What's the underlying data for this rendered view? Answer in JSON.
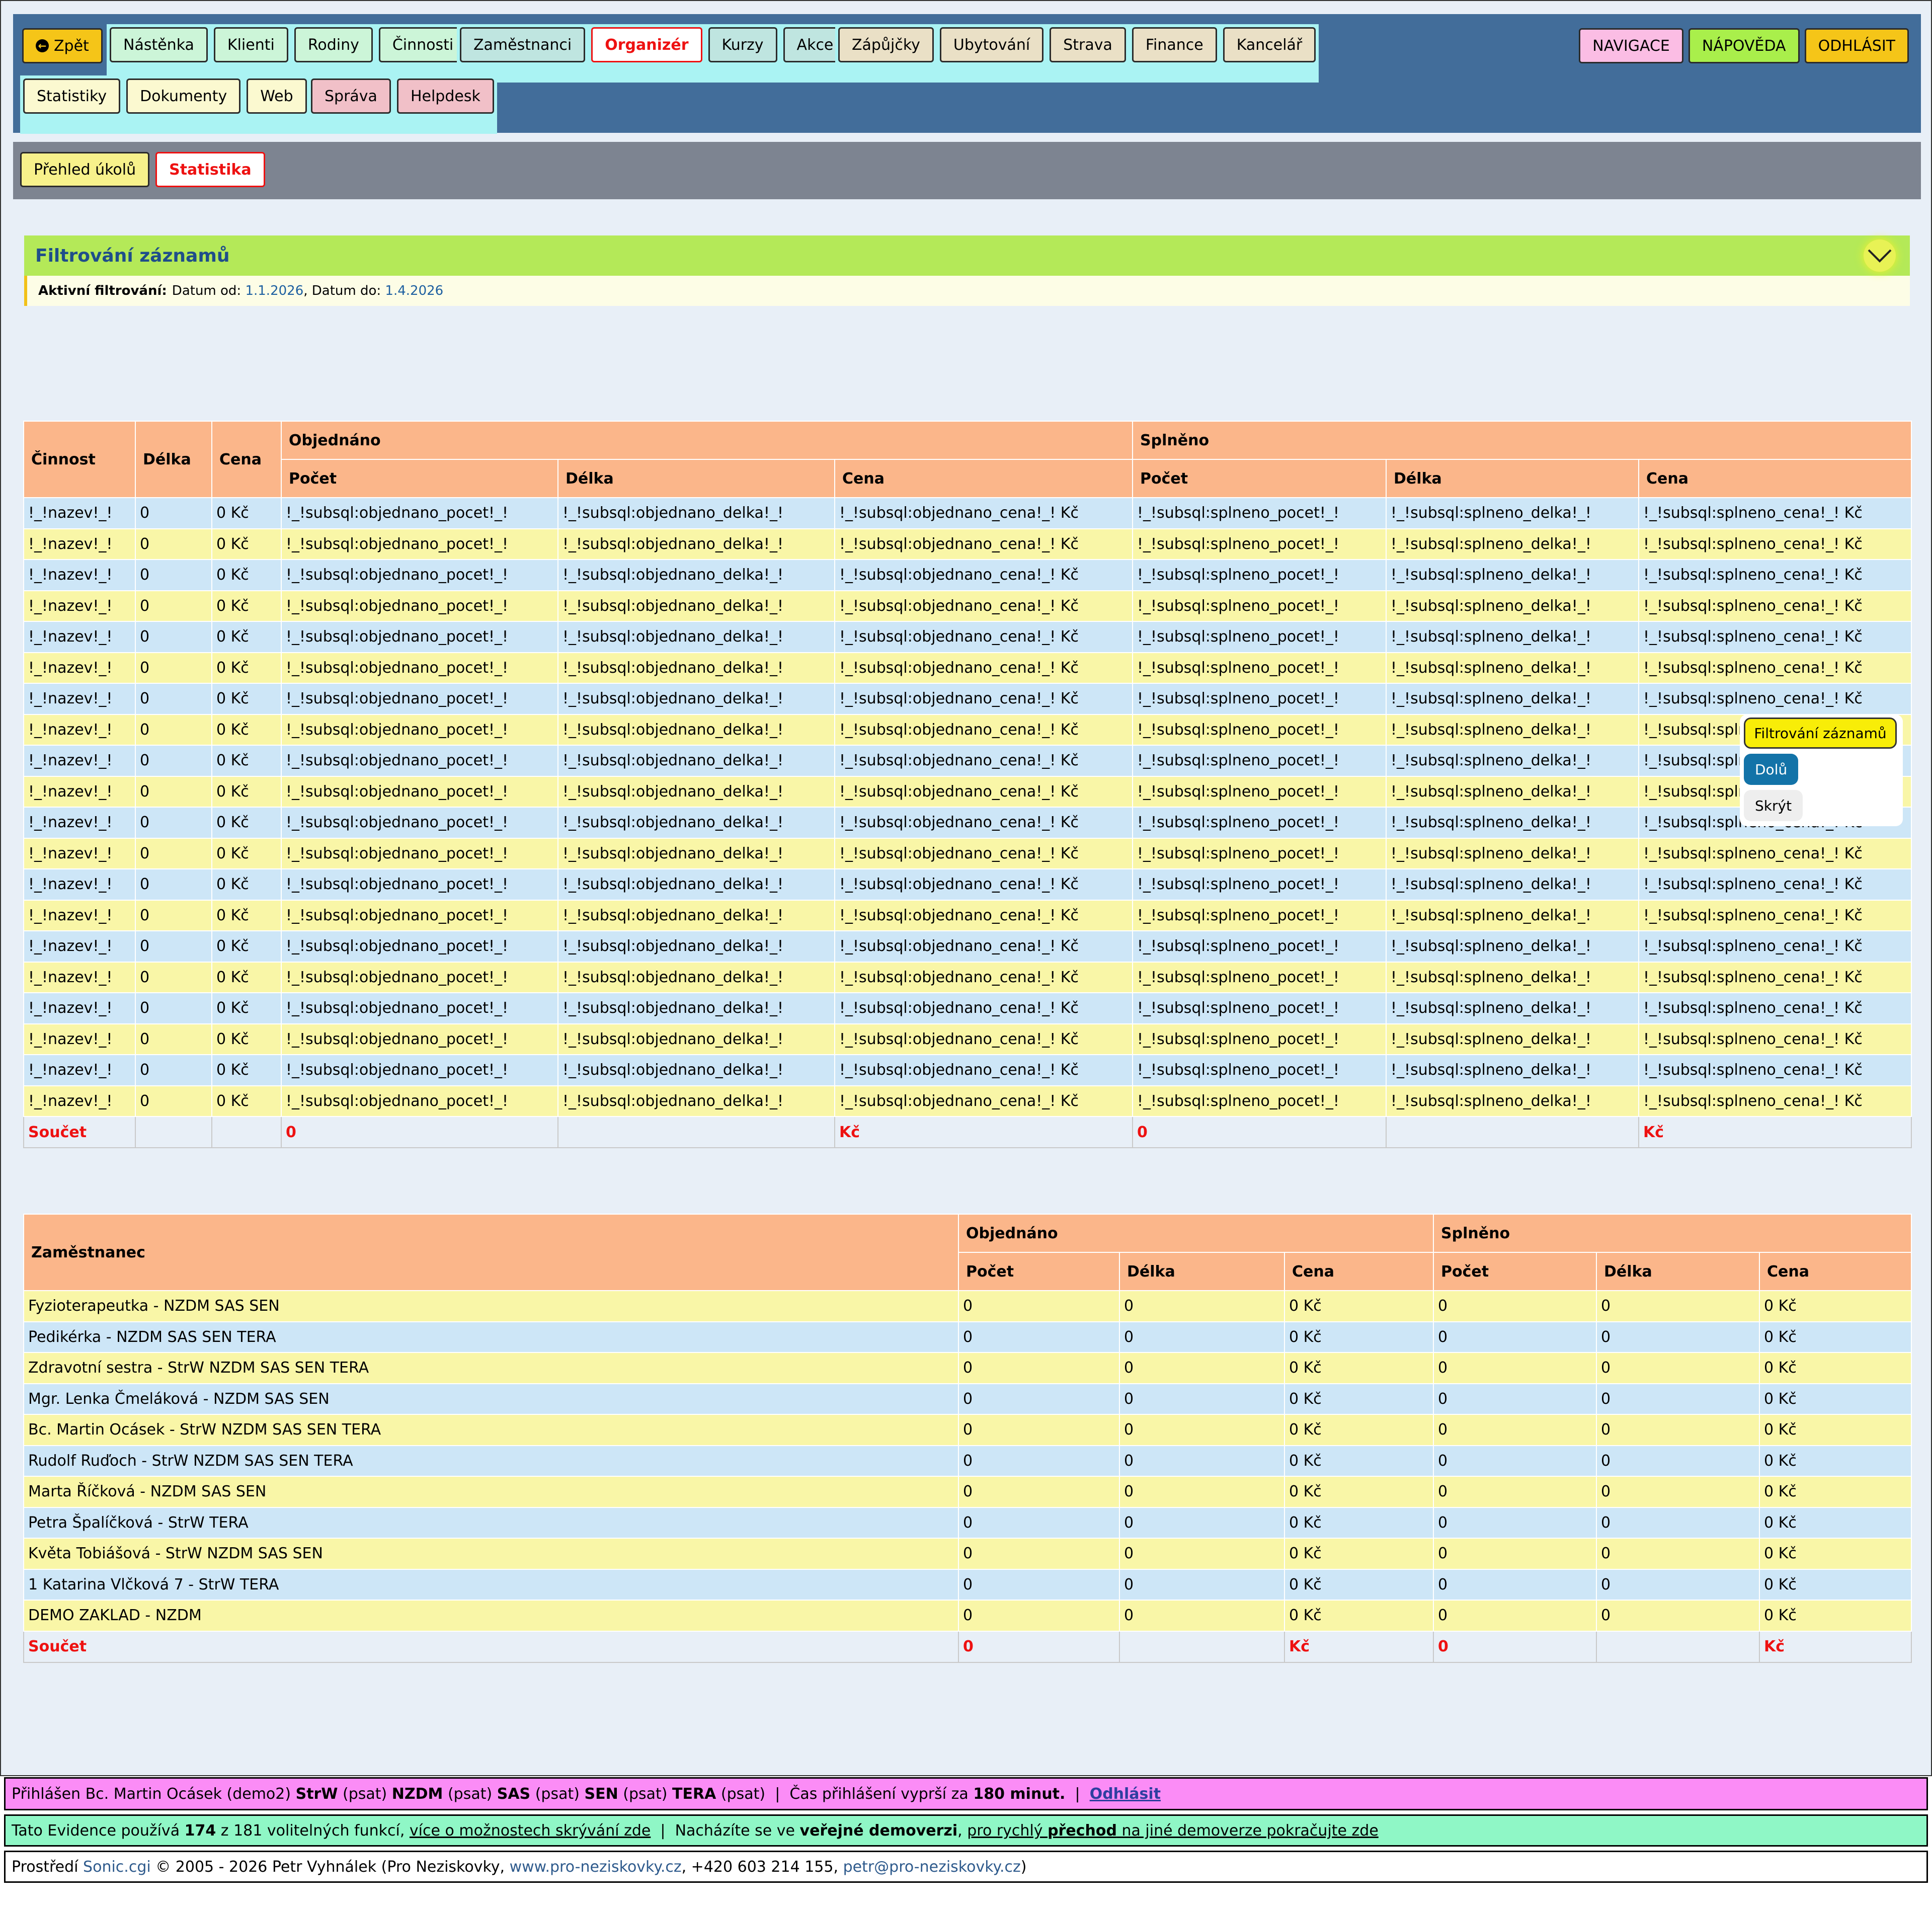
{
  "nav": {
    "groups": [
      {
        "style": "g-green",
        "items": [
          "Nástěnka",
          "Klienti",
          "Rodiny",
          "Činnosti"
        ]
      },
      {
        "style": "g-teal",
        "items": [
          "Zaměstnanci",
          "Organizér",
          "Kurzy",
          "Akce"
        ]
      },
      {
        "style": "g-beige",
        "items": [
          "Zápůjčky",
          "Ubytování",
          "Strava",
          "Finance",
          "Kancelář"
        ]
      },
      {
        "style": "g-yel",
        "items": [
          "Statistiky",
          "Dokumenty",
          "Web"
        ]
      },
      {
        "style": "g-pink",
        "items": [
          "Správa",
          "Helpdesk"
        ]
      }
    ],
    "back": "Zpět",
    "active": "Organizér",
    "right": [
      "NAVIGACE",
      "NÁPOVĚDA",
      "ODHLÁSIT"
    ]
  },
  "subnav": {
    "items": [
      "Přehled úkolů",
      "Statistika"
    ],
    "active": "Statistika"
  },
  "filter": {
    "title": "Filtrování záznamů",
    "active_label": "Aktivní filtrování:",
    "from_label": "Datum od:",
    "from": "1.1.2026",
    "sep": ", ",
    "to_label": "Datum do:",
    "to": "1.4.2026"
  },
  "table1": {
    "head": {
      "cinnost": "Činnost",
      "delka": "Délka",
      "cena": "Cena",
      "objednano": "Objednáno",
      "splneno": "Splněno",
      "pocet": "Počet",
      "delka2": "Délka",
      "cena2": "Cena"
    },
    "row": [
      "!_!nazev!_!",
      "0",
      "0 Kč",
      "!_!subsql:objednano_pocet!_!",
      "!_!subsql:objednano_delka!_!",
      "!_!subsql:objednano_cena!_! Kč",
      "!_!subsql:splneno_pocet!_!",
      "!_!subsql:splneno_delka!_!",
      "!_!subsql:splneno_cena!_! Kč"
    ],
    "row_count": 20,
    "sum": [
      "Součet",
      "",
      "",
      "0",
      "",
      "Kč",
      "0",
      "",
      "Kč"
    ]
  },
  "table2": {
    "head": {
      "zam": "Zaměstnanec",
      "objednano": "Objednáno",
      "splneno": "Splněno",
      "pocet": "Počet",
      "delka": "Délka",
      "cena": "Cena"
    },
    "rows": [
      [
        "Fyzioterapeutka - NZDM SAS SEN",
        "0",
        "0",
        "0 Kč",
        "0",
        "0",
        "0 Kč"
      ],
      [
        "Pedikérka - NZDM SAS SEN TERA",
        "0",
        "0",
        "0 Kč",
        "0",
        "0",
        "0 Kč"
      ],
      [
        "Zdravotní sestra - StrW NZDM SAS SEN TERA",
        "0",
        "0",
        "0 Kč",
        "0",
        "0",
        "0 Kč"
      ],
      [
        "Mgr. Lenka Čmeláková - NZDM SAS SEN",
        "0",
        "0",
        "0 Kč",
        "0",
        "0",
        "0 Kč"
      ],
      [
        "Bc. Martin Ocásek - StrW NZDM SAS SEN TERA",
        "0",
        "0",
        "0 Kč",
        "0",
        "0",
        "0 Kč"
      ],
      [
        "Rudolf Ruďoch - StrW NZDM SAS SEN TERA",
        "0",
        "0",
        "0 Kč",
        "0",
        "0",
        "0 Kč"
      ],
      [
        "Marta Říčková - NZDM SAS SEN",
        "0",
        "0",
        "0 Kč",
        "0",
        "0",
        "0 Kč"
      ],
      [
        "Petra Špalíčková - StrW TERA",
        "0",
        "0",
        "0 Kč",
        "0",
        "0",
        "0 Kč"
      ],
      [
        "Květa Tobiášová - StrW NZDM SAS SEN",
        "0",
        "0",
        "0 Kč",
        "0",
        "0",
        "0 Kč"
      ],
      [
        "1 Katarina Vlčková 7 - StrW TERA",
        "0",
        "0",
        "0 Kč",
        "0",
        "0",
        "0 Kč"
      ],
      [
        "DEMO ZAKLAD - NZDM",
        "0",
        "0",
        "0 Kč",
        "0",
        "0",
        "0 Kč"
      ]
    ],
    "sum": [
      "Součet",
      "0",
      "",
      "Kč",
      "0",
      "",
      "Kč"
    ]
  },
  "popup": {
    "title": "Filtrování záznamů",
    "down": "Dolů",
    "hide": "Skrýt"
  },
  "footer": {
    "login": {
      "prefix": "Přihlášen Bc. Martin Ocásek (demo2)",
      "roles": [
        [
          "StrW",
          "(psat)"
        ],
        [
          "NZDM",
          "(psat)"
        ],
        [
          "SAS",
          "(psat)"
        ],
        [
          "SEN",
          "(psat)"
        ],
        [
          "TERA",
          "(psat)"
        ]
      ],
      "sep": "|",
      "expire_pre": "Čas přihlášení vyprší za",
      "expire_val": "180 minut.",
      "logout": "Odhlásit"
    },
    "info": {
      "pre": "Tato Evidence používá",
      "count": "174",
      "mid": "z 181 volitelných funkcí,",
      "link1": "více o možnostech skrývání zde",
      "sep": "|",
      "text2": "Nacházíte se ve",
      "bold2": "veřejné demoverzi",
      "comma": ",",
      "link2a": "pro rychlý",
      "link2b": "přechod",
      "link2c": "na jiné demoverze pokračujte zde"
    },
    "copy": {
      "pre": "Prostředí",
      "sonic": "Sonic.cgi",
      "mid": "© 2005 - 2026 Petr Vyhnálek (Pro Neziskovky,",
      "web": "www.pro-neziskovky.cz",
      "phone": ", +420 603 214 155,",
      "mail": "petr@pro-neziskovky.cz",
      "end": ")"
    }
  },
  "colors": {
    "nav_bg": "#426d9a",
    "header_bg": "#fbb68a",
    "row_blue": "#cde6f7",
    "row_yellow": "#f9f6a7",
    "filter_bg": "#b4e958",
    "login_bar": "#fb8cf6",
    "info_bar": "#8ff7c6",
    "accent_red": "#e11111"
  }
}
